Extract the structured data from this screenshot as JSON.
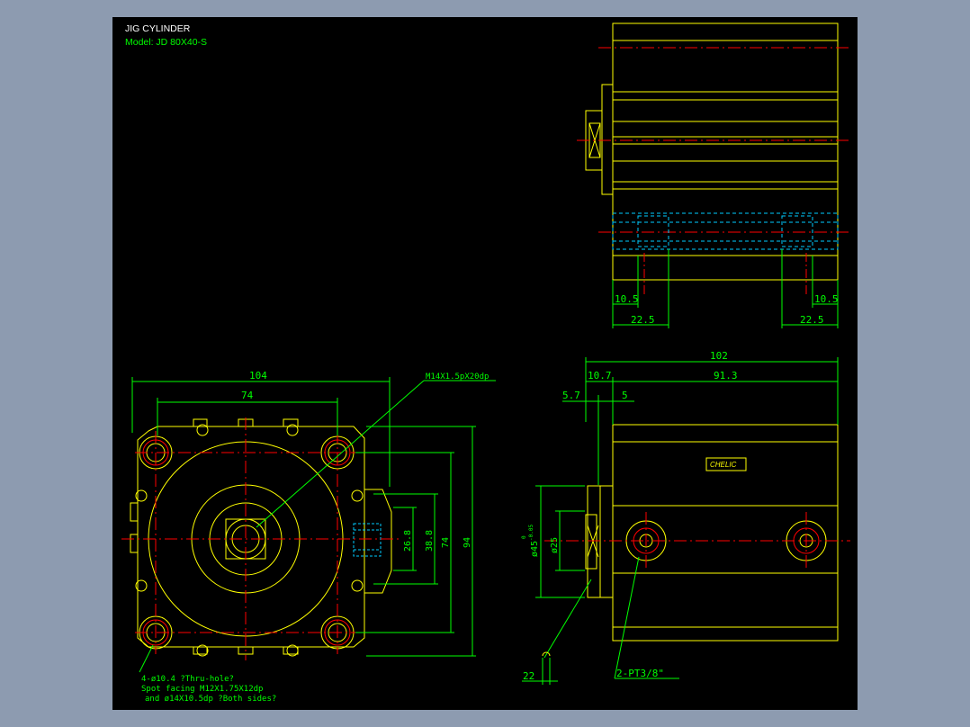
{
  "title": {
    "line1": "JIG CYLINDER",
    "line2": "Model: JD 80X40-S"
  },
  "colors": {
    "background_outer": "#8d9bb0",
    "background_canvas": "#000000",
    "outline": "#ffff00",
    "dimension": "#00ff00",
    "centerline": "#ff0000",
    "hidden": "#00ccff",
    "title_text": "#ffffff"
  },
  "top_right_view": {
    "dims": {
      "left_small": "10.5",
      "left_large": "22.5",
      "right_small": "10.5",
      "right_large": "22.5"
    }
  },
  "front_view": {
    "dims": {
      "overall_width": "104",
      "hole_pitch": "74",
      "thread_callout": "M14X1.5pX20dp",
      "port_small": "26.8",
      "port_large": "38.8",
      "height_pitch": "74",
      "overall_height": "94"
    },
    "notes": {
      "line1": "4-ø10.4 ?Thru-hole?",
      "line2": "Spot facing  M12X1.75X12dp",
      "line3": "and ø14X10.5dp ?Both sides?"
    }
  },
  "side_view": {
    "dims": {
      "overall_length": "102",
      "head_length": "10.7",
      "body_length": "91.3",
      "rod_extend": "5.7",
      "rod_gap": "5",
      "bore_dia": "ø45",
      "bore_tol_upper": "0",
      "bore_tol_lower": "-0.05",
      "rod_dia": "ø25",
      "wrench_flat": "22",
      "port_callout": "2-PT3/8\""
    },
    "label": {
      "brand": "CHELIC"
    }
  }
}
